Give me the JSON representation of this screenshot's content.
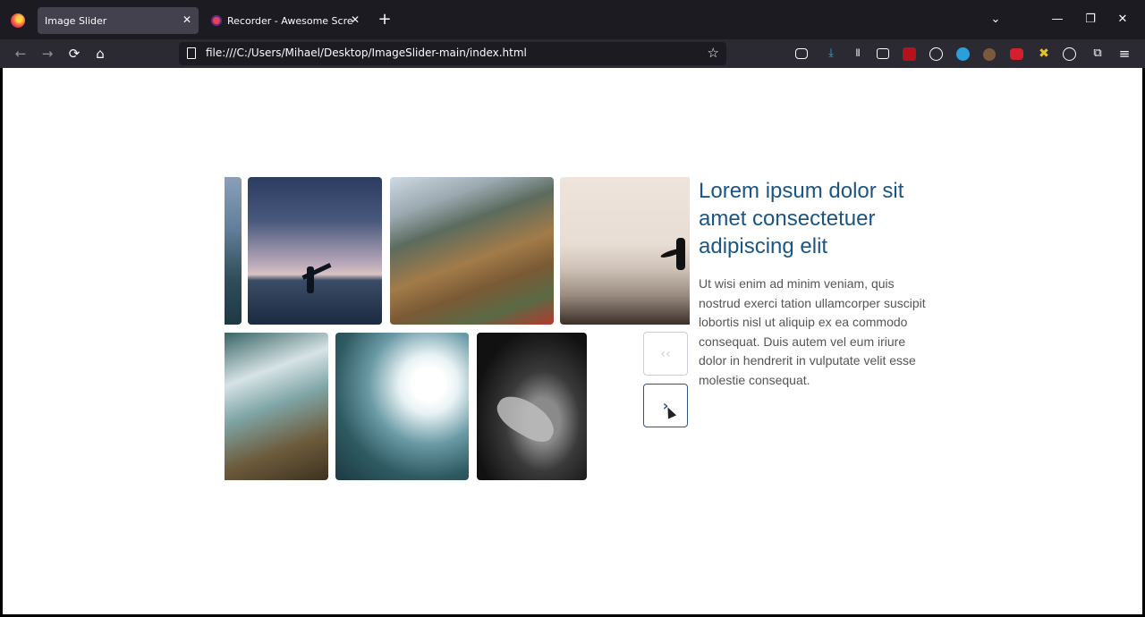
{
  "browser": {
    "tabs": [
      {
        "label": "Image Slider",
        "active": true
      },
      {
        "label": "Recorder - Awesome Screenshot",
        "active": false
      }
    ],
    "url": "file:///C:/Users/Mihael/Desktop/ImageSlider-main/index.html",
    "icons": {
      "back": "←",
      "forward": "→",
      "reload": "⟳",
      "home": "⌂",
      "new_tab": "+",
      "close": "✕",
      "bookmark_star": "☆",
      "tab_list": "⌄",
      "minimize": "—",
      "restore": "❐",
      "window_close": "✕",
      "menu": "≡"
    }
  },
  "page": {
    "heading": "Lorem ipsum dolor sit amet consectetuer adipiscing elit",
    "paragraph": "Ut wisi enim ad minim veniam, quis nostrud exerci tation ullamcorper suscipit lobortis nisl ut aliquip ex ea commodo consequat. Duis autem vel eum iriure dolor in hendrerit in vulputate velit esse molestie consequat.",
    "prev_arrow": "‹‹",
    "next_arrow": "›",
    "accent_color": "#1b5584"
  }
}
